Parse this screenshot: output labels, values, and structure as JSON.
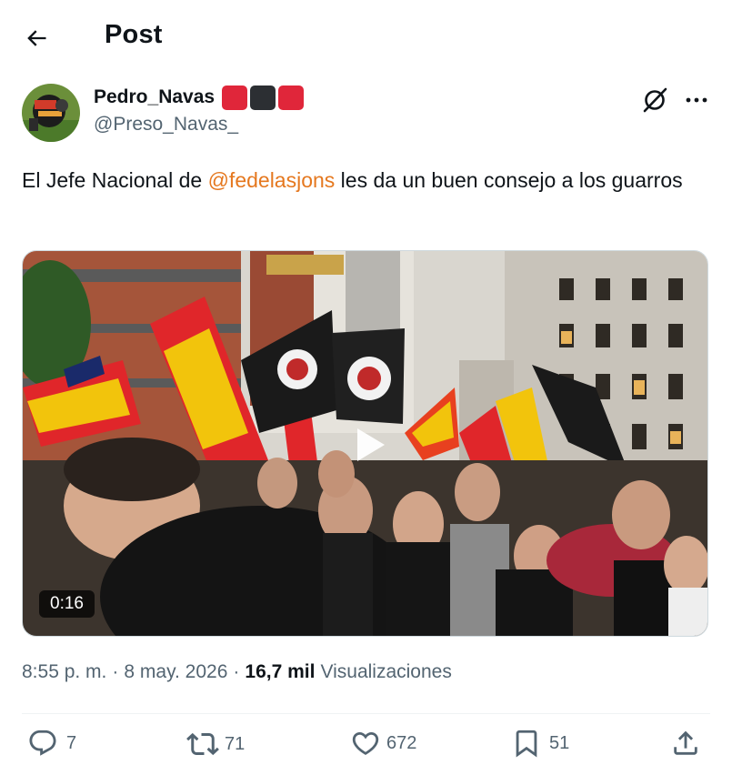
{
  "header": {
    "title": "Post"
  },
  "author": {
    "name": "Pedro_Navas",
    "handle": "@Preso_Navas_",
    "badge_colors": [
      "#e0263a",
      "#2c2f33",
      "#e0263a"
    ]
  },
  "tweet": {
    "text_before": "El Jefe Nacional de ",
    "mention": "@fedelasjons",
    "text_after": " les da un buen consejo a los guarros",
    "mention_color": "#e5781f"
  },
  "media": {
    "duration": "0:16"
  },
  "meta": {
    "time": "8:55 p. m.",
    "date": "8 may. 2026",
    "views_count": "16,7 mil",
    "views_label": "Visualizaciones"
  },
  "actions": {
    "replies": "7",
    "reposts": "71",
    "likes": "672",
    "bookmarks": "51"
  },
  "icons": [
    "back-arrow-icon",
    "grok-icon",
    "more-icon",
    "play-icon",
    "reply-icon",
    "repost-icon",
    "like-icon",
    "bookmark-icon",
    "share-icon"
  ]
}
